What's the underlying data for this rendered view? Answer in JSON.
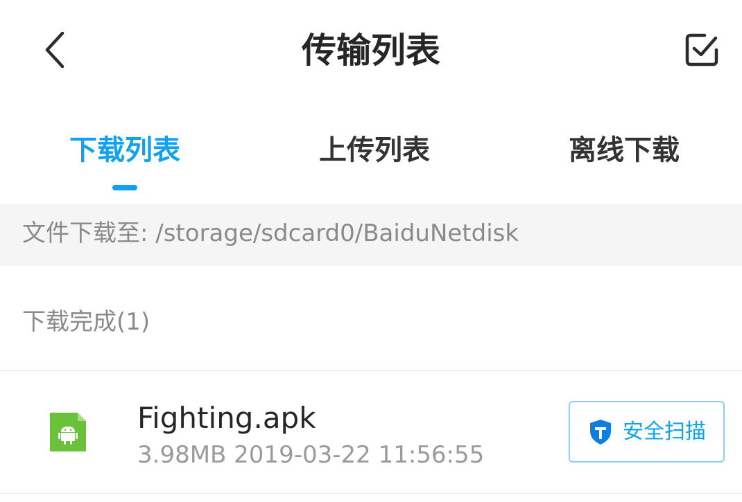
{
  "header": {
    "title": "传输列表",
    "back_icon": "chevron-left-icon",
    "select_icon": "checkbox-icon"
  },
  "tabs": [
    {
      "label": "下载列表",
      "active": true
    },
    {
      "label": "上传列表",
      "active": false
    },
    {
      "label": "离线下载",
      "active": false
    }
  ],
  "path_bar": {
    "text": "文件下载至: /storage/sdcard0/BaiduNetdisk"
  },
  "sections": [
    {
      "title": "下载完成(1)",
      "files": [
        {
          "name": "Fighting.apk",
          "meta": "3.98MB 2019-03-22 11:56:55",
          "icon": "android-file-icon",
          "action_label": "安全扫描",
          "action_icon": "shield-icon"
        }
      ]
    }
  ],
  "colors": {
    "accent": "#0ea2f0",
    "apk_icon": "#6cc13a",
    "title_text": "#262626",
    "muted_text": "#8a8a8a",
    "path_bg": "#f5f5f5"
  }
}
